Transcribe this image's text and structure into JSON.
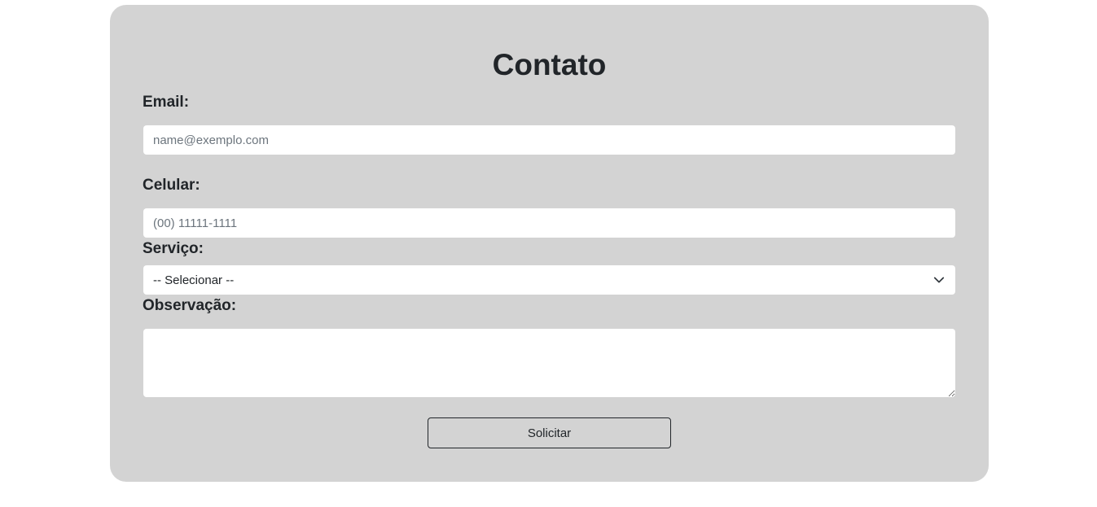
{
  "form": {
    "title": "Contato",
    "email": {
      "label": "Email:",
      "placeholder": "name@exemplo.com",
      "value": ""
    },
    "phone": {
      "label": "Celular:",
      "placeholder": "(00) 11111-1111",
      "value": ""
    },
    "service": {
      "label": "Serviço:",
      "selected": "-- Selecionar --",
      "icon": "chevron-down-icon"
    },
    "notes": {
      "label": "Observação:",
      "value": ""
    },
    "submit_label": "Solicitar"
  },
  "colors": {
    "card_background": "#d3d3d3",
    "text": "#212529",
    "placeholder": "#6c757d"
  }
}
